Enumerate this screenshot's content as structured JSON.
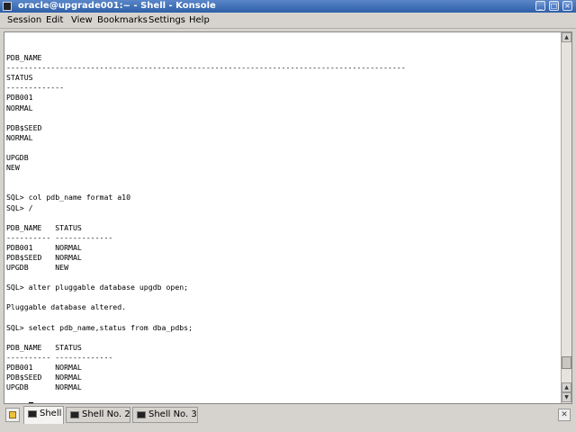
{
  "window": {
    "title": "oracle@upgrade001:~ - Shell - Konsole",
    "buttons": {
      "minimize": "_",
      "maximize": "□",
      "close": "×"
    }
  },
  "menu": [
    "Session",
    "Edit",
    "View",
    "Bookmarks",
    "Settings",
    "Help"
  ],
  "terminal": {
    "lines": [
      "",
      "PDB_NAME",
      "------------------------------------------------------------------------------------------",
      "STATUS",
      "-------------",
      "PDB001",
      "NORMAL",
      "",
      "PDB$SEED",
      "NORMAL",
      "",
      "UPGDB",
      "NEW",
      "",
      "",
      "SQL> col pdb_name format a10",
      "SQL> /",
      "",
      "PDB_NAME   STATUS",
      "---------- -------------",
      "PDB001     NORMAL",
      "PDB$SEED   NORMAL",
      "UPGDB      NEW",
      "",
      "SQL> alter pluggable database upgdb open;",
      "",
      "Pluggable database altered.",
      "",
      "SQL> select pdb_name,status from dba_pdbs;",
      "",
      "PDB_NAME   STATUS",
      "---------- -------------",
      "PDB001     NORMAL",
      "PDB$SEED   NORMAL",
      "UPGDB      NORMAL",
      ""
    ],
    "prompt": "SQL> ",
    "scroll_position_fraction": 0.96
  },
  "tabs": [
    {
      "label": "Shell",
      "active": true
    },
    {
      "label": "Shell No. 2",
      "active": false
    },
    {
      "label": "Shell No. 3",
      "active": false
    }
  ],
  "colors": {
    "titlebar": "#2e5fa8",
    "terminal_background": "#ffffff",
    "terminal_text": "#000000"
  }
}
